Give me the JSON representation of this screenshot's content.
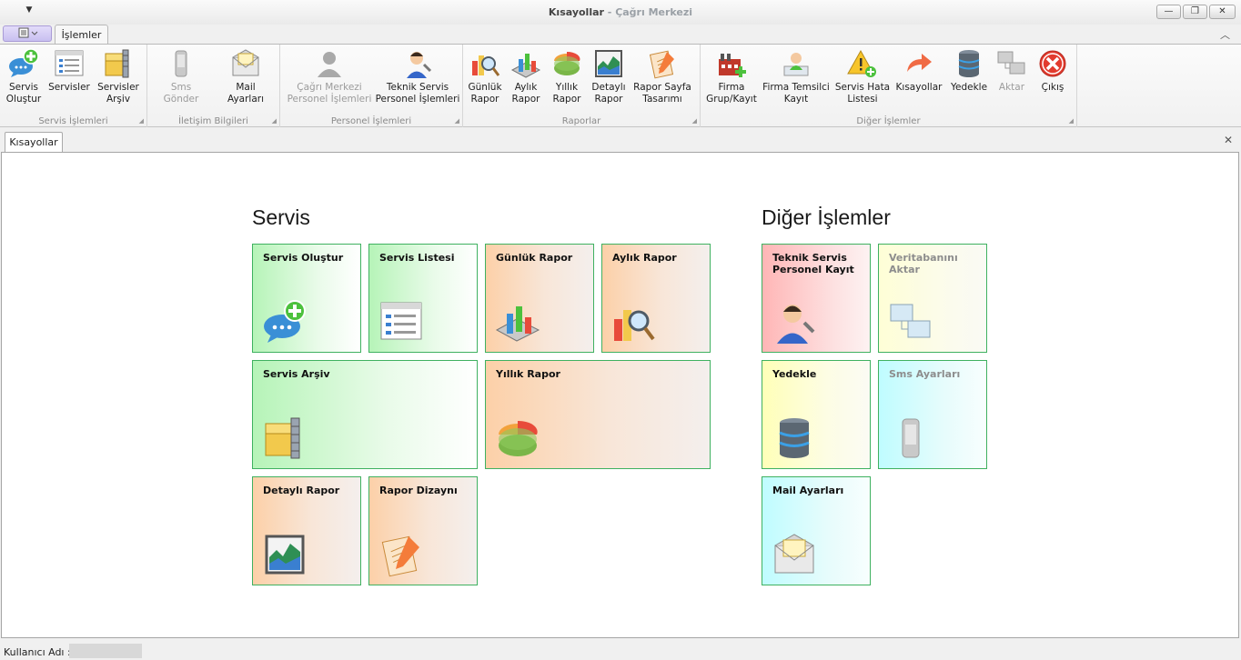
{
  "window": {
    "qat_icon": "dropdown-arrow-icon",
    "title_main": "Kısayollar",
    "title_sep": " - ",
    "title_app": "Çağrı Merkezi",
    "minimize": "—",
    "restore": "❐",
    "close": "✕"
  },
  "ribbon_tabs": {
    "app_menu_icon": "menu-list-icon",
    "active_tab": "İşlemler",
    "collapse_icon": "chevron-up-icon"
  },
  "groups": [
    {
      "label": "Servis İşlemleri",
      "buttons": [
        {
          "label": "Servis\nOluştur",
          "icon": "chat-bubble-add-icon",
          "enabled": true
        },
        {
          "label": "Servisler",
          "icon": "list-window-icon",
          "enabled": true
        },
        {
          "label": "Servisler\nArşiv",
          "icon": "archive-zipper-icon",
          "enabled": true
        }
      ]
    },
    {
      "label": "İletişim Bilgileri",
      "buttons": [
        {
          "label": "Sms Gönder",
          "icon": "mobile-phone-icon",
          "enabled": false
        },
        {
          "label": "Mail Ayarları",
          "icon": "envelope-icon",
          "enabled": true
        }
      ]
    },
    {
      "label": "Personel İşlemleri",
      "buttons": [
        {
          "label": "Çağrı Merkezi\nPersonel İşlemleri",
          "icon": "person-gray-icon",
          "enabled": false
        },
        {
          "label": "Teknik Servis\nPersonel İşlemleri",
          "icon": "technician-icon",
          "enabled": true
        }
      ]
    },
    {
      "label": "Raporlar",
      "buttons": [
        {
          "label": "Günlük\nRapor",
          "icon": "chart-magnifier-icon",
          "enabled": true
        },
        {
          "label": "Aylık\nRapor",
          "icon": "chart-3d-icon",
          "enabled": true
        },
        {
          "label": "Yıllık\nRapor",
          "icon": "pie-chart-icon",
          "enabled": true
        },
        {
          "label": "Detaylı\nRapor",
          "icon": "area-chart-icon",
          "enabled": true
        },
        {
          "label": "Rapor Sayfa\nTasarımı",
          "icon": "clipboard-pencil-icon",
          "enabled": true
        }
      ]
    },
    {
      "label": "Diğer İşlemler",
      "buttons": [
        {
          "label": "Firma\nGrup/Kayıt",
          "icon": "factory-add-icon",
          "enabled": true
        },
        {
          "label": "Firma Temsilci\nKayıt",
          "icon": "user-card-icon",
          "enabled": true
        },
        {
          "label": "Servis Hata\nListesi",
          "icon": "warning-add-icon",
          "enabled": true
        },
        {
          "label": "Kısayollar",
          "icon": "arrow-redo-icon",
          "enabled": true
        },
        {
          "label": "Yedekle",
          "icon": "database-icon",
          "enabled": true
        },
        {
          "label": "Aktar",
          "icon": "network-computers-icon",
          "enabled": false
        },
        {
          "label": "Çıkış",
          "icon": "exit-circle-icon",
          "enabled": true
        }
      ]
    }
  ],
  "doc_tab": {
    "label": "Kısayollar",
    "close": "✕"
  },
  "sections": {
    "servis_title": "Servis",
    "diger_title": "Diğer İşlemler"
  },
  "tiles": {
    "servis_olustur": "Servis Oluştur",
    "servis_listesi": "Servis Listesi",
    "gunluk_rapor": "Günlük Rapor",
    "aylik_rapor": "Aylık Rapor",
    "servis_arsiv": "Servis Arşiv",
    "yillik_rapor": "Yıllık Rapor",
    "detayli_rapor": "Detaylı Rapor",
    "rapor_dizayni": "Rapor Dizaynı",
    "teknik_servis": "Teknik Servis Personel Kayıt",
    "veritabani": "Veritabanını Aktar",
    "yedekle": "Yedekle",
    "sms_ayarlari": "Sms Ayarları",
    "mail_ayarlari": "Mail Ayarları"
  },
  "status": {
    "user_label": "Kullanıcı Adı :",
    "user_value": ""
  },
  "colors": {
    "tile_border": "#3fb160",
    "accent_purple": "#c8bff0"
  }
}
